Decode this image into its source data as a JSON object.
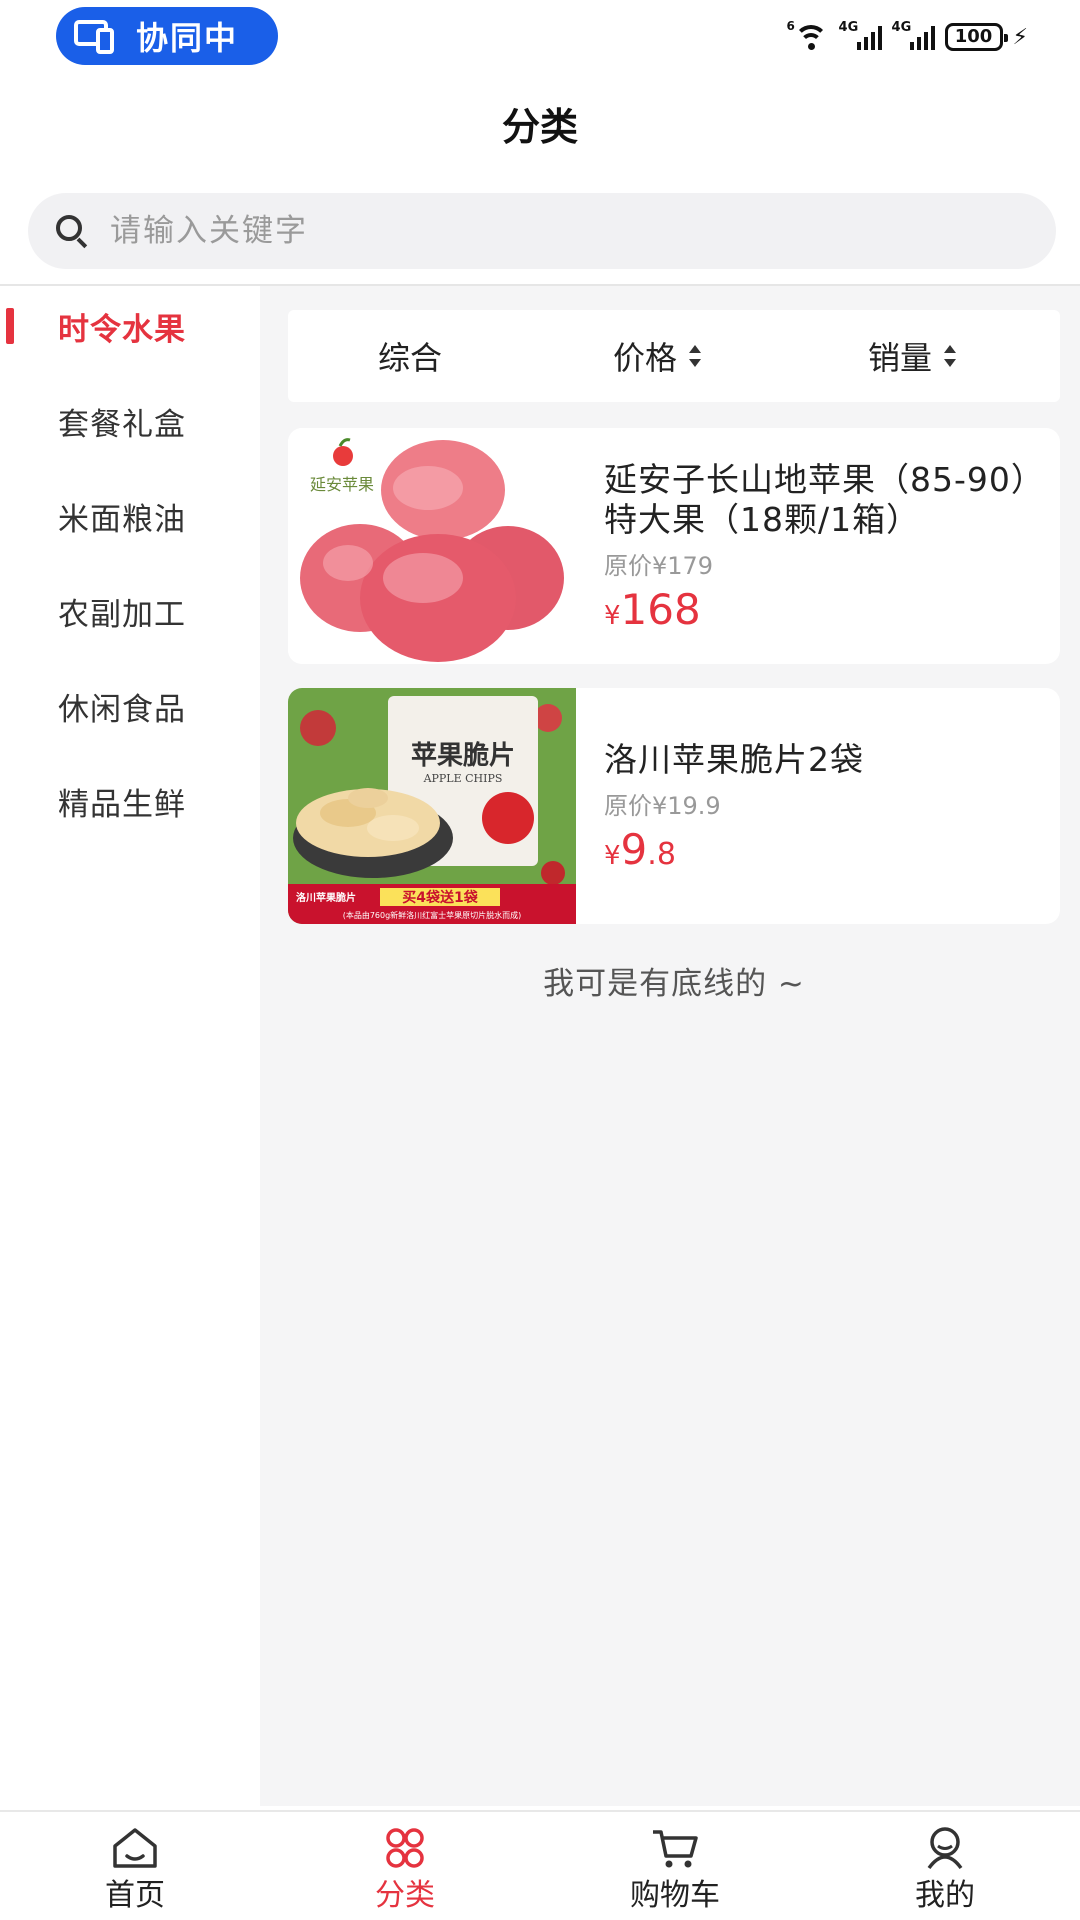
{
  "status_bar": {
    "collab_label": "协同中",
    "signal_label_1": "4G",
    "signal_label_2": "4G",
    "battery": "100",
    "wifi_badge": "6"
  },
  "header": {
    "title": "分类"
  },
  "search": {
    "placeholder": "请输入关键字"
  },
  "sidebar": {
    "items": [
      {
        "label": "时令水果"
      },
      {
        "label": "套餐礼盒"
      },
      {
        "label": "米面粮油"
      },
      {
        "label": "农副加工"
      },
      {
        "label": "休闲食品"
      },
      {
        "label": "精品生鲜"
      }
    ],
    "active_index": 0
  },
  "sort": {
    "comprehensive": "综合",
    "price": "价格",
    "sales": "销量"
  },
  "products": [
    {
      "name": "延安子长山地苹果（85-90）特大果（18颗/1箱）",
      "original_price": "原价¥179",
      "currency": "¥",
      "price_int": "168",
      "price_dec": "",
      "image_brand_text": "延安苹果"
    },
    {
      "name": "洛川苹果脆片2袋",
      "original_price": "原价¥19.9",
      "currency": "¥",
      "price_int": "9",
      "price_dec": ".8",
      "image_title": "苹果脆片",
      "image_subtitle": "APPLE CHIPS",
      "image_banner_left": "洛川苹果脆片",
      "image_banner_right": "买4袋送1袋",
      "image_footnote": "(本品由760g新鲜洛川红富士苹果原切片脱水而成)"
    }
  ],
  "list_end_text": "我可是有底线的 ~",
  "tabbar": {
    "items": [
      {
        "label": "首页"
      },
      {
        "label": "分类"
      },
      {
        "label": "购物车"
      },
      {
        "label": "我的"
      }
    ],
    "active_index": 1
  },
  "colors": {
    "accent": "#e5333f",
    "collab_blue": "#1a5fe8",
    "background_gray": "#f5f5f6"
  }
}
